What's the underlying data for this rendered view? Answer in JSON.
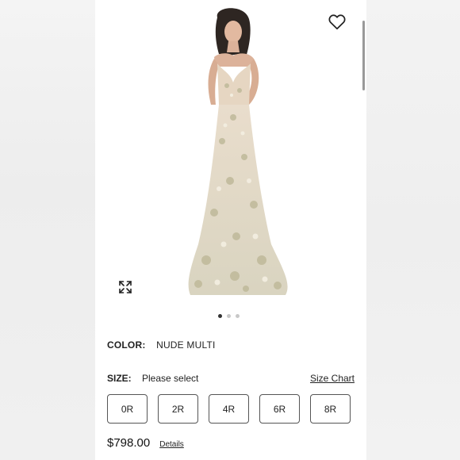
{
  "product": {
    "color_label": "COLOR:",
    "color_value": "NUDE MULTI",
    "size_label": "SIZE:",
    "size_value": "Please select",
    "size_chart_link": "Size Chart",
    "sizes": [
      "0R",
      "2R",
      "4R",
      "6R",
      "8R"
    ],
    "price": "$798.00",
    "details_link": "Details"
  },
  "gallery": {
    "image_count": 3,
    "active_index": 0
  },
  "icons": {
    "wishlist": "heart-outline-icon",
    "expand": "expand-arrows-icon"
  }
}
